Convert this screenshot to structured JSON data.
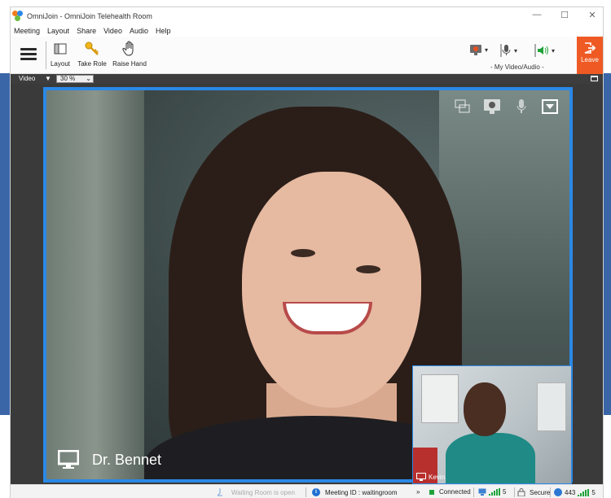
{
  "window": {
    "title": "OmniJoin - OmniJoin Telehealth Room",
    "controls": {
      "minimize": "—",
      "maximize": "☐",
      "close": "✕"
    }
  },
  "menu": [
    "Meeting",
    "Layout",
    "Share",
    "Video",
    "Audio",
    "Help"
  ],
  "toolbar": {
    "layout_label": "Layout",
    "take_role_label": "Take Role",
    "raise_hand_label": "Raise Hand",
    "devices_label": "- My Video/Audio -",
    "leave_label": "Leave"
  },
  "video_bar": {
    "label": "Video",
    "zoom_value": "30 %"
  },
  "main_video": {
    "participant_name": "Dr. Bennet"
  },
  "pip_video": {
    "participant_name": "Kevin"
  },
  "status_bar": {
    "waiting_room": "Waiting Room is open",
    "meeting_id": "Meeting ID : waitingroom",
    "more": "»",
    "connection": "Connected",
    "signal_count": "5",
    "security": "Secure",
    "port": "443",
    "port_signal": "5"
  },
  "colors": {
    "accent_blue": "#2b88e6",
    "leave_orange": "#ef5a24",
    "connected_green": "#1fa33a"
  },
  "icons": [
    "hamburger-icon",
    "layout-icon",
    "key-icon",
    "hand-icon",
    "camera-icon",
    "mic-icon",
    "speaker-icon",
    "leave-icon",
    "popout-icon",
    "screen-icon",
    "monitor-icon",
    "menu-icon",
    "info-icon",
    "lock-icon",
    "globe-icon",
    "signal-icon"
  ]
}
